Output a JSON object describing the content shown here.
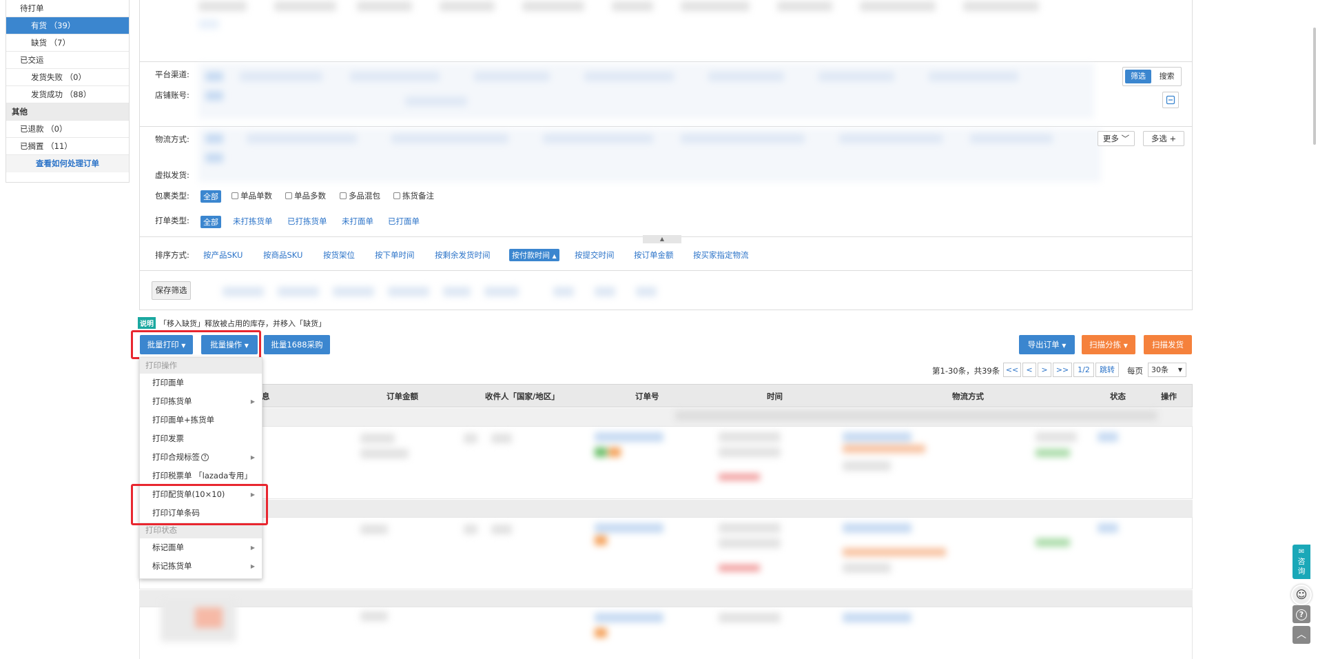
{
  "sidebar": {
    "items": [
      {
        "label": "待打单",
        "kind": "parent"
      },
      {
        "label": "有货 （39）",
        "kind": "active"
      },
      {
        "label": "缺货 （7）",
        "kind": "sub"
      },
      {
        "label": "已交运",
        "kind": "parent"
      },
      {
        "label": "发货失败 （0）",
        "kind": "sub"
      },
      {
        "label": "发货成功 （88）",
        "kind": "sub"
      },
      {
        "label": "其他",
        "kind": "group"
      },
      {
        "label": "已退款 （0）",
        "kind": "parent"
      },
      {
        "label": "已搁置 （11）",
        "kind": "parent"
      }
    ],
    "help_link": "查看如何处理订单"
  },
  "filters": {
    "platform_label": "平台渠道:",
    "shop_label": "店铺账号:",
    "logistics_label": "物流方式:",
    "virtual_label": "虚拟发货:",
    "filter_btn": "筛选",
    "search_btn": "搜索",
    "more_btn": "更多",
    "multi_btn": "多选 +",
    "package": {
      "label": "包裹类型:",
      "selected": "全部",
      "options": [
        "单品单数",
        "单品多数",
        "多品混包",
        "拣货备注"
      ]
    },
    "print_type": {
      "label": "打单类型:",
      "selected": "全部",
      "options": [
        "未打拣货单",
        "已打拣货单",
        "未打面单",
        "已打面单"
      ]
    },
    "sort": {
      "label": "排序方式:",
      "options": [
        "按产品SKU",
        "按商品SKU",
        "按货架位",
        "按下单时间",
        "按剩余发货时间"
      ],
      "selected": "按付款时间",
      "options_after": [
        "按提交时间",
        "按订单金额",
        "按买家指定物流"
      ]
    },
    "save_btn": "保存筛选"
  },
  "notice": {
    "badge": "说明",
    "text": "「移入缺货」释放被占用的库存，并移入「缺货」"
  },
  "actions": {
    "batch_print": "批量打印",
    "batch_ops": "批量操作",
    "batch_1688": "批量1688采购",
    "export": "导出订单",
    "scan_sort": "扫描分拣",
    "scan_ship": "扫描发货"
  },
  "pagination": {
    "summary": "第1-30条，共39条",
    "first": "<<",
    "prev": "<",
    "next": ">",
    "last": ">>",
    "page": "1/2",
    "jump": "跳转",
    "per_page_label": "每页",
    "per_page": "30条"
  },
  "table": {
    "headers": [
      "息",
      "订单金额",
      "收件人「国家/地区」",
      "订单号",
      "时间",
      "物流方式",
      "状态",
      "操作"
    ]
  },
  "dropdown": {
    "header_ops": "打印操作",
    "items": [
      {
        "label": "打印面单",
        "submenu": false
      },
      {
        "label": "打印拣货单",
        "submenu": true
      },
      {
        "label": "打印面单+拣货单",
        "submenu": false
      },
      {
        "label": "打印发票",
        "submenu": false
      },
      {
        "label": "打印合规标签",
        "submenu": true,
        "help": true
      },
      {
        "label": "打印税票单 「lazada专用」",
        "submenu": false
      },
      {
        "label": "打印配货单(10×10)",
        "submenu": true
      },
      {
        "label": "打印订单条码",
        "submenu": false
      }
    ],
    "header_status": "打印状态",
    "status_items": [
      {
        "label": "标记面单",
        "submenu": true
      },
      {
        "label": "标记拣货单",
        "submenu": true
      }
    ]
  },
  "consult": {
    "label": "咨询"
  },
  "colors": {
    "accent": "#3b86cf",
    "orange": "#f5813c",
    "highlight": "#e8262f"
  }
}
